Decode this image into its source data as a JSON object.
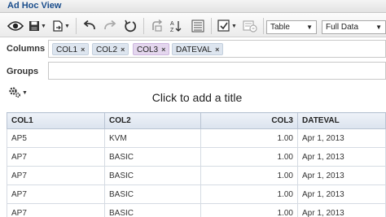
{
  "window": {
    "title": "Ad Hoc View"
  },
  "toolbar": {
    "icons": [
      "eye-icon",
      "save-icon",
      "export-icon",
      "undo-icon",
      "redo-icon",
      "undo-all-icon",
      "pivot-icon",
      "sort-icon",
      "input-controls-icon",
      "filter-icon",
      "sql-icon"
    ],
    "visualization_select": {
      "value": "Table"
    },
    "data_select": {
      "value": "Full Data"
    }
  },
  "columns": {
    "label": "Columns",
    "chips": [
      "COL1",
      "COL2",
      "COL3",
      "DATEVAL"
    ]
  },
  "groups": {
    "label": "Groups"
  },
  "report": {
    "title_placeholder": "Click to add a title"
  },
  "table": {
    "headers": [
      "COL1",
      "COL2",
      "COL3",
      "DATEVAL"
    ],
    "rows": [
      [
        "AP5",
        "KVM",
        "1.00",
        "Apr 1, 2013"
      ],
      [
        "AP7",
        "BASIC",
        "1.00",
        "Apr 1, 2013"
      ],
      [
        "AP7",
        "BASIC",
        "1.00",
        "Apr 1, 2013"
      ],
      [
        "AP7",
        "BASIC",
        "1.00",
        "Apr 1, 2013"
      ],
      [
        "AP7",
        "BASIC",
        "1.00",
        "Apr 1, 2013"
      ]
    ]
  },
  "colors": {
    "title_text": "#1a4d8c",
    "dimension_chip": "#dde5ef",
    "measure_chip": "#e4d6ee"
  }
}
